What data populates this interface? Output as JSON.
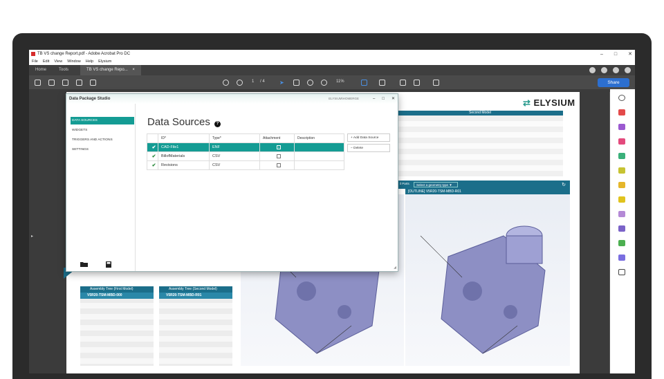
{
  "window": {
    "title": "TB VS change Report.pdf - Adobe Acrobat Pro DC",
    "controls": [
      "–",
      "□",
      "✕"
    ]
  },
  "menu": [
    "File",
    "Edit",
    "View",
    "Window",
    "Help",
    "Elysium"
  ],
  "tabs": [
    {
      "label": "Home"
    },
    {
      "label": "Tools"
    },
    {
      "label": "TB VS change Repo...",
      "close": "×"
    }
  ],
  "toolbar": {
    "page_current": "1",
    "page_total": "/ 4",
    "zoom": "11%",
    "share_label": "Share"
  },
  "page": {
    "logo_text": "ELYSIUM",
    "second_model_header": "Second Model",
    "parts_label": "il Parts",
    "geometry_select": "Select a geometry type ▼",
    "viewer_sub_label": "[OUTLINE] V5R20-TSM-MBD-R01",
    "tree_left_header": "Assembly Tree (First Model)",
    "tree_left_row": "V5R20-TSM-MBD-000",
    "tree_right_header": "Assembly Tree (Second Model)",
    "tree_right_row": "V5R20-TSM-MBD-R01"
  },
  "dialog": {
    "title": "Data Package Studio",
    "user": "ELYSIUM\\HOMERGE",
    "controls": [
      "–",
      "□",
      "✕"
    ],
    "nav": [
      {
        "label": "DATA SOURCES",
        "active": true
      },
      {
        "label": "WIDGETS",
        "active": false
      },
      {
        "label": "TRIGGERS AND ACTIONS",
        "active": false
      },
      {
        "label": "SETTINGS",
        "active": false
      }
    ],
    "heading": "Data Sources",
    "help": "?",
    "table": {
      "columns": [
        "ID*",
        "Type*",
        "Attachment",
        "Description"
      ],
      "rows": [
        {
          "id": "CAD-File1",
          "type": "ENF",
          "attachment": true,
          "description": "",
          "selected": true
        },
        {
          "id": "BillofMaterials",
          "type": "CSV",
          "attachment": false,
          "description": "",
          "selected": false
        },
        {
          "id": "Revisions",
          "type": "CSV",
          "attachment": false,
          "description": "",
          "selected": false
        }
      ]
    },
    "actions": {
      "add_label": "+ Add Data Source",
      "delete_label": "− Delete"
    }
  },
  "colors": {
    "accent_teal": "#149c94",
    "header_blue": "#1b6e8a",
    "share_blue": "#2c6fd0"
  }
}
